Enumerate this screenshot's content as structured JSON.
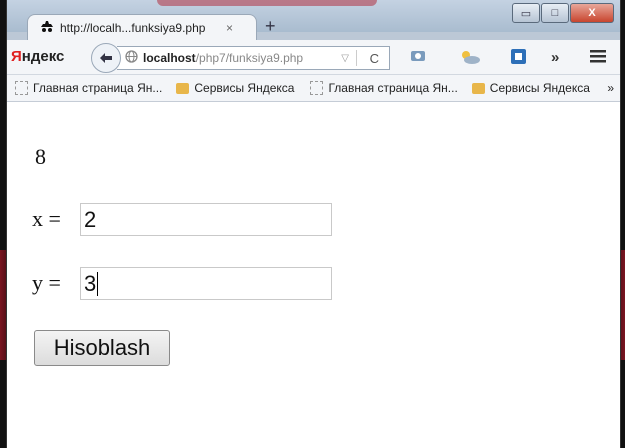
{
  "browser": {
    "tab_title": "http://localh...funksiya9.php",
    "tab_close": "×",
    "new_tab": "+",
    "logo_first": "Я",
    "logo_rest": "ндекс",
    "url_host": "localhost",
    "url_path": "/php7/funksiya9.php",
    "caption": {
      "minimize": "▭",
      "maximize": "□",
      "close": "X"
    }
  },
  "bookmarks": [
    {
      "label": "Главная страница Ян...",
      "icon": "page-icon"
    },
    {
      "label": "Сервисы Яндекса",
      "icon": "folder-icon"
    },
    {
      "label": "Главная страница Ян...",
      "icon": "page-icon"
    },
    {
      "label": "Сервисы Яндекса",
      "icon": "folder-icon"
    }
  ],
  "bookmarks_more": "»",
  "page": {
    "result": "8",
    "x_label": "x =",
    "x_value": "2",
    "y_label": "y =",
    "y_value": "3",
    "button": "Hisoblash"
  }
}
